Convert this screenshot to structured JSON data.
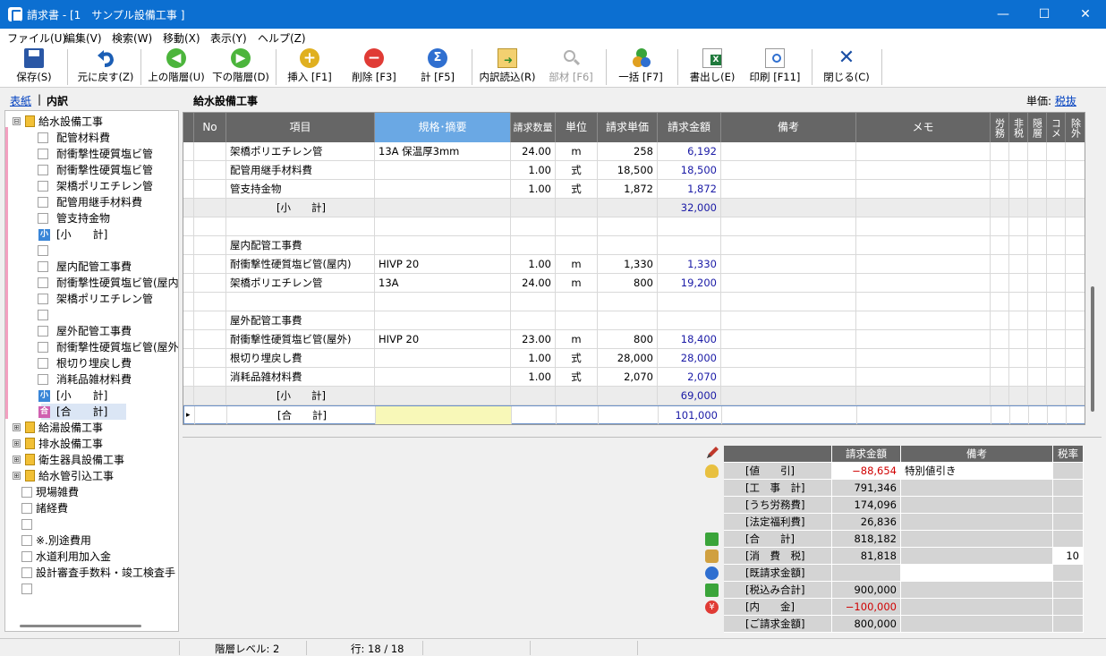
{
  "window": {
    "title": "請求書 - [1　サンプル設備工事 ]",
    "minimize": "—",
    "maximize": "☐",
    "close": "✕"
  },
  "menu": [
    "ファイル(U)",
    "編集(V)",
    "検索(W)",
    "移動(X)",
    "表示(Y)",
    "ヘルプ(Z)"
  ],
  "toolbar": {
    "save": "保存(S)",
    "undo": "元に戻す(Z)",
    "up": "上の階層(U)",
    "down": "下の階層(D)",
    "insert": "挿入 [F1]",
    "delete": "削除 [F3]",
    "total": "計 [F5]",
    "import": "内訳読込(R)",
    "parts": "部材 [F6]",
    "bulk": "一括 [F7]",
    "export": "書出し(E)",
    "print": "印刷 [F11]",
    "close": "閉じる(C)"
  },
  "left": {
    "tab_cover": "表紙",
    "sep": "|",
    "tab_detail": "内訳"
  },
  "tree": [
    {
      "label": "給水設備工事",
      "indent": 0,
      "kind": "folder",
      "pm": "⊟"
    },
    {
      "label": "配管材料費",
      "indent": 1,
      "kind": "cb"
    },
    {
      "label": "耐衝撃性硬質塩ビ管",
      "indent": 1,
      "kind": "cb"
    },
    {
      "label": "耐衝撃性硬質塩ビ管",
      "indent": 1,
      "kind": "cb"
    },
    {
      "label": "架橋ポリエチレン管",
      "indent": 1,
      "kind": "cb"
    },
    {
      "label": "配管用継手材料費",
      "indent": 1,
      "kind": "cb"
    },
    {
      "label": "管支持金物",
      "indent": 1,
      "kind": "cb"
    },
    {
      "label": "[小　　計]",
      "indent": 1,
      "kind": "tag",
      "tag": "小"
    },
    {
      "label": "",
      "indent": 1,
      "kind": "cb"
    },
    {
      "label": "屋内配管工事費",
      "indent": 1,
      "kind": "cb"
    },
    {
      "label": "耐衝撃性硬質塩ビ管(屋内",
      "indent": 1,
      "kind": "cb"
    },
    {
      "label": "架橋ポリエチレン管",
      "indent": 1,
      "kind": "cb"
    },
    {
      "label": "",
      "indent": 1,
      "kind": "cb"
    },
    {
      "label": "屋外配管工事費",
      "indent": 1,
      "kind": "cb"
    },
    {
      "label": "耐衝撃性硬質塩ビ管(屋外",
      "indent": 1,
      "kind": "cb"
    },
    {
      "label": "根切り埋戻し費",
      "indent": 1,
      "kind": "cb"
    },
    {
      "label": "消耗品雑材料費",
      "indent": 1,
      "kind": "cb"
    },
    {
      "label": "[小　　計]",
      "indent": 1,
      "kind": "tag",
      "tag": "小"
    },
    {
      "label": "[合　　計]",
      "indent": 1,
      "kind": "tag",
      "tag": "合"
    },
    {
      "label": "給湯設備工事",
      "indent": 0,
      "kind": "folder",
      "pm": "⊞"
    },
    {
      "label": "排水設備工事",
      "indent": 0,
      "kind": "folder",
      "pm": "⊞"
    },
    {
      "label": "衛生器具設備工事",
      "indent": 0,
      "kind": "folder",
      "pm": "⊞"
    },
    {
      "label": "給水管引込工事",
      "indent": 0,
      "kind": "folder",
      "pm": "⊞"
    },
    {
      "label": "現場雑費",
      "indent": 0,
      "kind": "cb"
    },
    {
      "label": "諸経費",
      "indent": 0,
      "kind": "cb"
    },
    {
      "label": "",
      "indent": 0,
      "kind": "cb"
    },
    {
      "label": "※.別途費用",
      "indent": 0,
      "kind": "cb"
    },
    {
      "label": "水道利用加入金",
      "indent": 0,
      "kind": "cb"
    },
    {
      "label": "設計審査手数料・竣工検査手",
      "indent": 0,
      "kind": "cb"
    },
    {
      "label": "",
      "indent": 0,
      "kind": "cb"
    }
  ],
  "section_title": "給水設備工事",
  "unit": {
    "label": "単価:",
    "link": "税抜"
  },
  "grid": {
    "headers": [
      "No",
      "項目",
      "規格･摘要",
      "請求数量",
      "単位",
      "請求単価",
      "請求金額",
      "備考",
      "メモ",
      "労務",
      "非税",
      "隠層",
      "コメ",
      "除外"
    ],
    "rows": [
      [
        "",
        "架橋ポリエチレン管",
        "13A 保温厚3mm",
        "24.00",
        "m",
        "258",
        "6,192",
        "",
        ""
      ],
      [
        "",
        "配管用継手材料費",
        "",
        "1.00",
        "式",
        "18,500",
        "18,500",
        "",
        ""
      ],
      [
        "",
        "管支持金物",
        "",
        "1.00",
        "式",
        "1,872",
        "1,872",
        "",
        ""
      ],
      [
        "",
        "[小　　計]",
        "",
        "",
        "",
        "",
        "32,000",
        "",
        ""
      ],
      [
        "",
        "",
        "",
        "",
        "",
        "",
        "",
        "",
        ""
      ],
      [
        "",
        "屋内配管工事費",
        "",
        "",
        "",
        "",
        "",
        "",
        ""
      ],
      [
        "",
        "耐衝撃性硬質塩ビ管(屋内)",
        "HIVP 20",
        "1.00",
        "m",
        "1,330",
        "1,330",
        "",
        ""
      ],
      [
        "",
        "架橋ポリエチレン管",
        "13A",
        "24.00",
        "m",
        "800",
        "19,200",
        "",
        ""
      ],
      [
        "",
        "",
        "",
        "",
        "",
        "",
        "",
        "",
        ""
      ],
      [
        "",
        "屋外配管工事費",
        "",
        "",
        "",
        "",
        "",
        "",
        ""
      ],
      [
        "",
        "耐衝撃性硬質塩ビ管(屋外)",
        "HIVP 20",
        "23.00",
        "m",
        "800",
        "18,400",
        "",
        ""
      ],
      [
        "",
        "根切り埋戻し費",
        "",
        "1.00",
        "式",
        "28,000",
        "28,000",
        "",
        ""
      ],
      [
        "",
        "消耗品雑材料費",
        "",
        "1.00",
        "式",
        "2,070",
        "2,070",
        "",
        ""
      ],
      [
        "",
        "[小　　計]",
        "",
        "",
        "",
        "",
        "69,000",
        "",
        ""
      ],
      [
        "",
        "[合　　計]",
        "",
        "",
        "",
        "",
        "101,000",
        "",
        ""
      ]
    ],
    "row_marker": "▸"
  },
  "summary": {
    "headers": [
      "請求金額",
      "備考",
      "税率"
    ],
    "rows": [
      {
        "label": "[値　　引]",
        "value": "−88,654",
        "note": "特別値引き",
        "rate": "",
        "red": true,
        "icon": "discount-icon"
      },
      {
        "label": "[工　事　計]",
        "value": "791,346",
        "note": "",
        "rate": "",
        "red": false,
        "icon": ""
      },
      {
        "label": "[うち労務費]",
        "value": "174,096",
        "note": "",
        "rate": "",
        "red": false,
        "icon": ""
      },
      {
        "label": "[法定福利費]",
        "value": "26,836",
        "note": "",
        "rate": "",
        "red": false,
        "icon": ""
      },
      {
        "label": "[合　　計]",
        "value": "818,182",
        "note": "",
        "rate": "",
        "red": false,
        "icon": "sum-icon"
      },
      {
        "label": "[消　費　税]",
        "value": "81,818",
        "note": "",
        "rate": "10",
        "red": false,
        "icon": "tax-icon"
      },
      {
        "label": "[既請求金額]",
        "value": "",
        "note": "",
        "rate": "",
        "red": false,
        "icon": "billed-icon"
      },
      {
        "label": "[税込み合計]",
        "value": "900,000",
        "note": "",
        "rate": "",
        "red": false,
        "icon": "sum-icon"
      },
      {
        "label": "[内　　金]",
        "value": "−100,000",
        "note": "",
        "rate": "",
        "red": true,
        "icon": "yen-icon"
      },
      {
        "label": "[ご請求金額]",
        "value": "800,000",
        "note": "",
        "rate": "",
        "red": false,
        "icon": ""
      }
    ]
  },
  "status": {
    "level": "階層レベル: 2",
    "row": "行: 18 / 18"
  }
}
